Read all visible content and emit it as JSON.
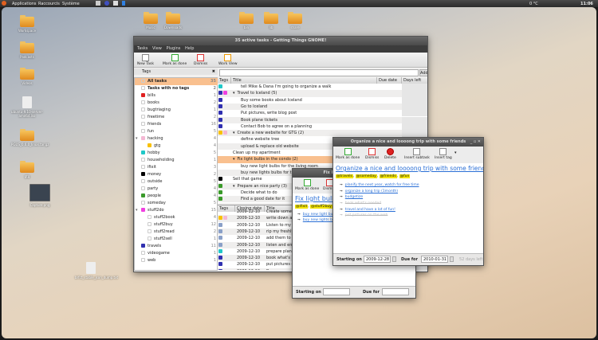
{
  "panel": {
    "menus": [
      "Applications",
      "Raccourcis",
      "Système"
    ],
    "weather": "0 °C",
    "clock": "11:06"
  },
  "desktop": {
    "icons": [
      "Workspace",
      "Podcasts",
      "Videos",
      "ubuntu-9.10-server-amd64.iso",
      "PGUS_0.6.0_linux.tar.gz",
      "gtg",
      "Capture.png",
      "brfct_stable_json_dump.txt",
      "Music",
      "Downloads",
      "bin",
      "lib",
      "share"
    ]
  },
  "main": {
    "title": "35 active tasks - Getting Things GNOME!",
    "menu": [
      "Tasks",
      "View",
      "Plugins",
      "Help"
    ],
    "toolbar": [
      "New Task",
      "Mark as done",
      "Dismiss",
      "Work View"
    ],
    "tags_header": "Tags",
    "add_label": "Add",
    "search_value": "",
    "columns": [
      "Tags",
      "Title",
      "Due date",
      "Days left"
    ],
    "closed_columns": [
      "Tags",
      "Closing date",
      "Title"
    ],
    "tags": [
      {
        "name": "All tasks",
        "count": "35",
        "bold": true,
        "sel": true
      },
      {
        "name": "Tasks with no tags",
        "count": "2",
        "bold": true
      },
      {
        "name": "bills",
        "count": "1",
        "color": "#e02020"
      },
      {
        "name": "books",
        "count": "2"
      },
      {
        "name": "bugtriaging",
        "count": "1"
      },
      {
        "name": "freetime",
        "count": "2"
      },
      {
        "name": "friends",
        "count": "16"
      },
      {
        "name": "fun",
        "count": "5"
      },
      {
        "name": "hacking",
        "count": "4",
        "color": "#f4b8d4",
        "exp": true
      },
      {
        "name": "gtg",
        "count": "4",
        "color": "#f8c000",
        "sub": true
      },
      {
        "name": "hobby",
        "count": "5",
        "color": "#20c8c8"
      },
      {
        "name": "householding",
        "count": "1"
      },
      {
        "name": "ifixit",
        "count": "3"
      },
      {
        "name": "money",
        "count": "2",
        "color": "#000000"
      },
      {
        "name": "outside",
        "count": "5"
      },
      {
        "name": "party",
        "count": "4"
      },
      {
        "name": "people",
        "count": "4",
        "color": "#3a9a2a"
      },
      {
        "name": "someday",
        "count": "5"
      },
      {
        "name": "stuff2do",
        "count": "15",
        "color": "#f040e0",
        "exp": true
      },
      {
        "name": "stuff2book",
        "count": "4",
        "sub": true
      },
      {
        "name": "stuff2buy",
        "count": "12",
        "sub": true
      },
      {
        "name": "stuff2read",
        "count": "2",
        "sub": true
      },
      {
        "name": "stuff2sell",
        "count": "1",
        "sub": true
      },
      {
        "name": "travels",
        "count": "11",
        "color": "#3030b0"
      },
      {
        "name": "videogame",
        "count": "1"
      },
      {
        "name": "web",
        "count": "1"
      }
    ],
    "tasks": [
      {
        "title": "tell Mike & Dana I'm going to organize a walk",
        "lvl": 2,
        "tags": [
          "#20c8c8"
        ]
      },
      {
        "title": "Travel to Iceland (5)",
        "lvl": 1,
        "exp": true,
        "tags": [
          "#3030b0",
          "#f040e0"
        ]
      },
      {
        "title": "Buy some books about Iceland",
        "lvl": 2,
        "tags": [
          "#3030b0"
        ]
      },
      {
        "title": "Go to Iceland",
        "lvl": 2,
        "tags": [
          "#3030b0"
        ]
      },
      {
        "title": "Put pictures, write blog post",
        "lvl": 2,
        "tags": [
          "#3030b0"
        ]
      },
      {
        "title": "Book plane tickets",
        "lvl": 2,
        "tags": [
          "#3030b0"
        ]
      },
      {
        "title": "Contact Bob to agree on a planning",
        "lvl": 2,
        "tags": [
          "#3030b0"
        ]
      },
      {
        "title": "Create a new website for GTG (2)",
        "lvl": 1,
        "exp": true,
        "tags": [
          "#f8c000",
          "#f4b8d4"
        ]
      },
      {
        "title": "define website tree",
        "lvl": 2,
        "tags": []
      },
      {
        "title": "upload & replace old website",
        "lvl": 2,
        "tags": []
      },
      {
        "title": "Clean up my apartment",
        "lvl": 1,
        "tags": []
      },
      {
        "title": "Fix light bulbs in the condo (2)",
        "lvl": 1,
        "exp": true,
        "sel": true,
        "tags": []
      },
      {
        "title": "buy new light bulbs for the living room",
        "lvl": 2,
        "tags": []
      },
      {
        "title": "buy new lights bulbs for the kitchen",
        "lvl": 2,
        "tags": []
      },
      {
        "title": "Sell that game",
        "lvl": 1,
        "tags": [
          "#000000"
        ]
      },
      {
        "title": "Prepare an nice party (3)",
        "lvl": 1,
        "exp": true,
        "tags": [
          "#3a9a2a"
        ]
      },
      {
        "title": "Decide what to do",
        "lvl": 2,
        "tags": [
          "#3a9a2a"
        ]
      },
      {
        "title": "Find a good date for it",
        "lvl": 2,
        "tags": [
          "#3a9a2a"
        ]
      }
    ],
    "closed": [
      {
        "date": "2009-12-10",
        "title": "Create some bl",
        "tags": []
      },
      {
        "date": "2009-12-10",
        "title": "write down a p",
        "tags": [
          "#f8c000",
          "#f4b8d4"
        ]
      },
      {
        "date": "2009-12-10",
        "title": "Listen to my re",
        "tags": [
          "#8aa0c8"
        ]
      },
      {
        "date": "2009-12-10",
        "title": "rip my freshly-b",
        "tags": [
          "#8aa0c8"
        ]
      },
      {
        "date": "2009-12-10",
        "title": "add them to ba",
        "tags": [
          "#8aa0c8"
        ]
      },
      {
        "date": "2009-12-10",
        "title": "listen and enjoy",
        "tags": [
          "#8aa0c8"
        ]
      },
      {
        "date": "2009-12-10",
        "title": "prepare plannin",
        "tags": [
          "#20c8c8"
        ]
      },
      {
        "date": "2009-12-10",
        "title": "book what's ne",
        "tags": [
          "#3030b0"
        ]
      },
      {
        "date": "2009-12-10",
        "title": "put pictures on",
        "tags": [
          "#3030b0"
        ]
      },
      {
        "date": "2009-12-10",
        "title": "Buy warm gear",
        "tags": [
          "#3030b0"
        ]
      }
    ]
  },
  "fix_editor": {
    "window_title": "Fix light bulbs in the condo",
    "toolbar": [
      "Mark as done",
      "Dismiss"
    ],
    "title": "Fix light bulbs in the condo",
    "tags": [
      "@ifixit",
      "@stuff2buy"
    ],
    "subtasks": [
      "buy new light bulbs for the living room",
      "buy new lights bulbs for the kitchen"
    ],
    "start_label": "Starting on",
    "start_value": "",
    "due_label": "Due for",
    "due_value": ""
  },
  "org_editor": {
    "window_title": "Organize a nice and loooong trip with some friends",
    "toolbar": [
      "Mark as done",
      "Dismiss",
      "Delete",
      "Insert subtask",
      "Insert tag"
    ],
    "title": "Organize a nice and loooong trip with some friends",
    "tags": [
      "@travels",
      "@someday",
      "@friends",
      "@fun"
    ],
    "subtasks": [
      {
        "t": "planify the next year, watch for free time",
        "done": false
      },
      {
        "t": "organize a long trip (1month)",
        "done": false
      },
      {
        "t": "budgetize",
        "done": false
      },
      {
        "t": "book what's needed",
        "done": true
      },
      {
        "t": "travel and have a lot of fun!",
        "done": false
      },
      {
        "t": "put pictures on the web",
        "done": true
      }
    ],
    "start_label": "Starting on",
    "start_value": "2009-12-28",
    "due_label": "Due for",
    "due_value": "2010-01-31",
    "days_left": "52 days left"
  }
}
